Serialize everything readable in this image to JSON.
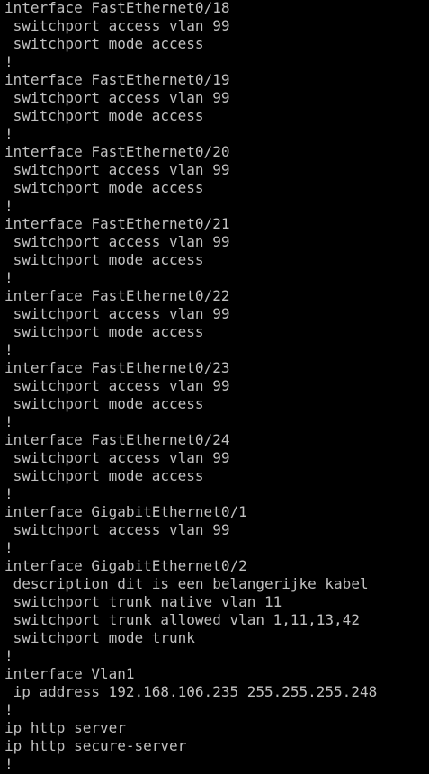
{
  "terminal": {
    "lines": [
      "interface FastEthernet0/18",
      " switchport access vlan 99",
      " switchport mode access",
      "!",
      "interface FastEthernet0/19",
      " switchport access vlan 99",
      " switchport mode access",
      "!",
      "interface FastEthernet0/20",
      " switchport access vlan 99",
      " switchport mode access",
      "!",
      "interface FastEthernet0/21",
      " switchport access vlan 99",
      " switchport mode access",
      "!",
      "interface FastEthernet0/22",
      " switchport access vlan 99",
      " switchport mode access",
      "!",
      "interface FastEthernet0/23",
      " switchport access vlan 99",
      " switchport mode access",
      "!",
      "interface FastEthernet0/24",
      " switchport access vlan 99",
      " switchport mode access",
      "!",
      "interface GigabitEthernet0/1",
      " switchport access vlan 99",
      "!",
      "interface GigabitEthernet0/2",
      " description dit is een belangerijke kabel",
      " switchport trunk native vlan 11",
      " switchport trunk allowed vlan 1,11,13,42",
      " switchport mode trunk",
      "!",
      "interface Vlan1",
      " ip address 192.168.106.235 255.255.255.248",
      "!",
      "ip http server",
      "ip http secure-server",
      "!"
    ]
  },
  "colors": {
    "background": "#000000",
    "text": "#c0c0c0"
  }
}
